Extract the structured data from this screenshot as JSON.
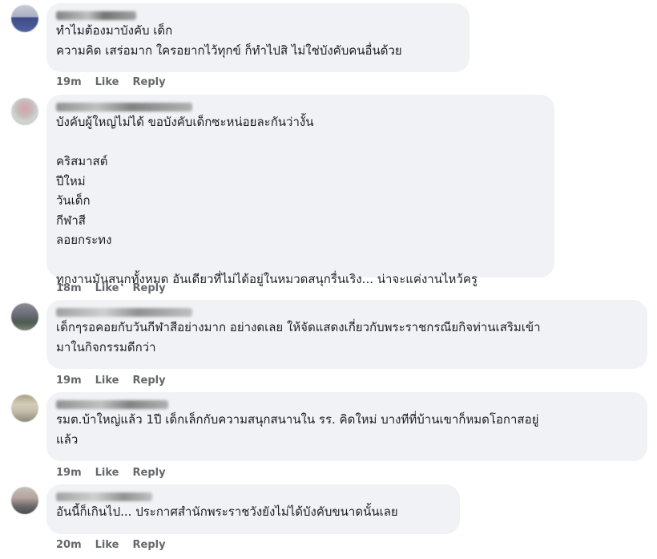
{
  "comments": [
    {
      "text": "ทำไมต้องมาบังคับ เด็ก\nความคิด เสร่อมาก ใครอยากไว้ทุกข์ ก็ทำไปสิ ไม่ใช่บังคับคนอื่นด้วย",
      "time": "19m",
      "like": "Like",
      "reply": "Reply"
    },
    {
      "text": "บังคับผู้ใหญ่ไม่ได้ ขอบังคับเด็กซะหน่อยละกันว่างั้น\n\nคริสมาสต์\nปีใหม่\nวันเด็ก\nกีฬาสี\nลอยกระทง\n\nทุกงานมันสนุกทั้งหมด อันเดียวที่ไม่ได้อยู่ในหมวดสนุกรื่นเริง... น่าจะแค่งานไหว้ครู",
      "time": "18m",
      "like": "Like",
      "reply": "Reply"
    },
    {
      "text": "เด็กๆรอคอยกับวันกีฬาสีอย่างมาก อย่างดเลย ให้จัดแสดงเกี่ยวกับพระราชกรณียกิจท่านเสริมเข้า\nมาในกิจกรรมดีกว่า",
      "time": "19m",
      "like": "Like",
      "reply": "Reply"
    },
    {
      "text": "รมต.บ้าใหญ่แล้ว 1ปี เด็กเล็กกับความสนุกสนานใน รร. คิดใหม่ บางทีที่บ้านเขาก็หมดโอกาสอยู่\nแล้ว",
      "time": "19m",
      "like": "Like",
      "reply": "Reply"
    },
    {
      "text": "อันนี้ก็เกินไป... ประกาศสำนักพระราชวังยังไม่ได้บังคับขนาดนั้นเลย",
      "time": "20m",
      "like": "Like",
      "reply": "Reply"
    }
  ]
}
